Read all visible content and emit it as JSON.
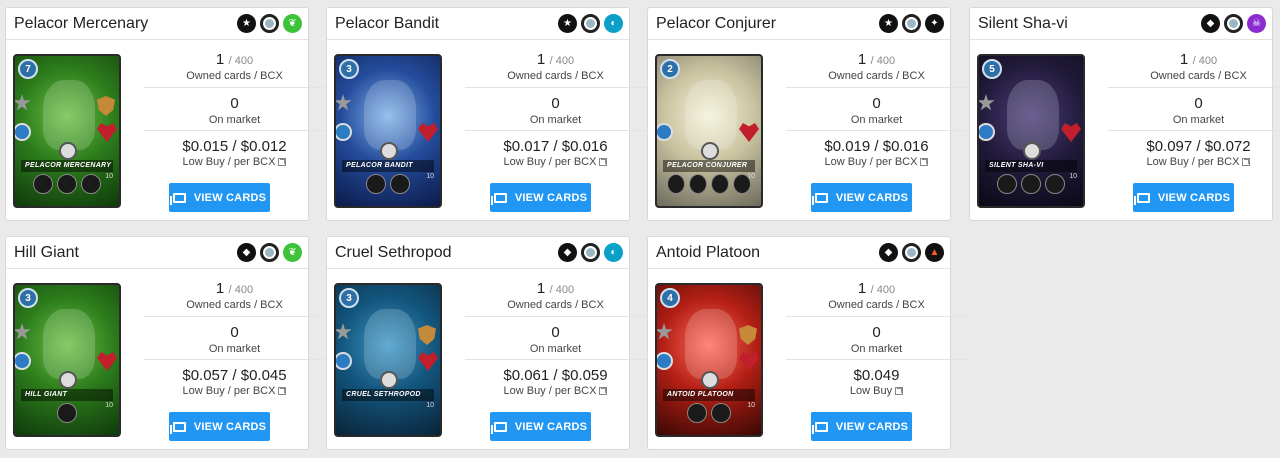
{
  "button_label": "VIEW CARDS",
  "labels": {
    "owned": "Owned cards / BCX",
    "on_market": "On market",
    "low_buy_bcx": "Low Buy / per BCX",
    "low_buy": "Low Buy"
  },
  "colors": {
    "button": "#2196f3",
    "earth": "#3ec23a",
    "water": "#0ba0c8",
    "death": "#8b2bd1",
    "fire": "#ff5a2a"
  },
  "cards": [
    {
      "name": "Pelacor Mercenary",
      "card_title": "PELACOR MERCENARY",
      "owned": "1",
      "owned_total": "/ 400",
      "market": "0",
      "price": "$0.015 / $0.012",
      "price_label": "Low Buy / per BCX",
      "level": "10",
      "mana": "7",
      "badges": [
        "rarity-icon",
        "neutral-mana-icon",
        "earth-element-icon"
      ]
    },
    {
      "name": "Pelacor Bandit",
      "card_title": "PELACOR BANDIT",
      "owned": "1",
      "owned_total": "/ 400",
      "market": "0",
      "price": "$0.017 / $0.016",
      "price_label": "Low Buy / per BCX",
      "level": "10",
      "mana": "3",
      "badges": [
        "rarity-icon",
        "neutral-mana-icon",
        "water-element-icon"
      ]
    },
    {
      "name": "Pelacor Conjurer",
      "card_title": "PELACOR CONJURER",
      "owned": "1",
      "owned_total": "/ 400",
      "market": "0",
      "price": "$0.019 / $0.016",
      "price_label": "Low Buy / per BCX",
      "level": "10",
      "mana": "2",
      "badges": [
        "rarity-icon",
        "neutral-mana-icon",
        "life-element-icon"
      ]
    },
    {
      "name": "Silent Sha-vi",
      "card_title": "SILENT SHA-VI",
      "owned": "1",
      "owned_total": "/ 400",
      "market": "0",
      "price": "$0.097 / $0.072",
      "price_label": "Low Buy / per BCX",
      "level": "10",
      "mana": "5",
      "badges": [
        "rarity-icon",
        "neutral-mana-icon",
        "death-element-icon"
      ]
    },
    {
      "name": "Hill Giant",
      "card_title": "HILL GIANT",
      "owned": "1",
      "owned_total": "/ 400",
      "market": "0",
      "price": "$0.057 / $0.045",
      "price_label": "Low Buy / per BCX",
      "level": "10",
      "mana": "3",
      "badges": [
        "rarity-icon",
        "neutral-mana-icon",
        "earth-element-icon"
      ]
    },
    {
      "name": "Cruel Sethropod",
      "card_title": "CRUEL SETHROPOD",
      "owned": "1",
      "owned_total": "/ 400",
      "market": "0",
      "price": "$0.061 / $0.059",
      "price_label": "Low Buy / per BCX",
      "level": "10",
      "mana": "3",
      "badges": [
        "rarity-icon",
        "neutral-mana-icon",
        "water-element-icon"
      ]
    },
    {
      "name": "Antoid Platoon",
      "card_title": "ANTOID PLATOON",
      "owned": "1",
      "owned_total": "/ 400",
      "market": "0",
      "price": "$0.049",
      "price_label": "Low Buy",
      "level": "10",
      "mana": "4",
      "badges": [
        "rarity-icon",
        "neutral-mana-icon",
        "fire-element-icon"
      ]
    }
  ]
}
